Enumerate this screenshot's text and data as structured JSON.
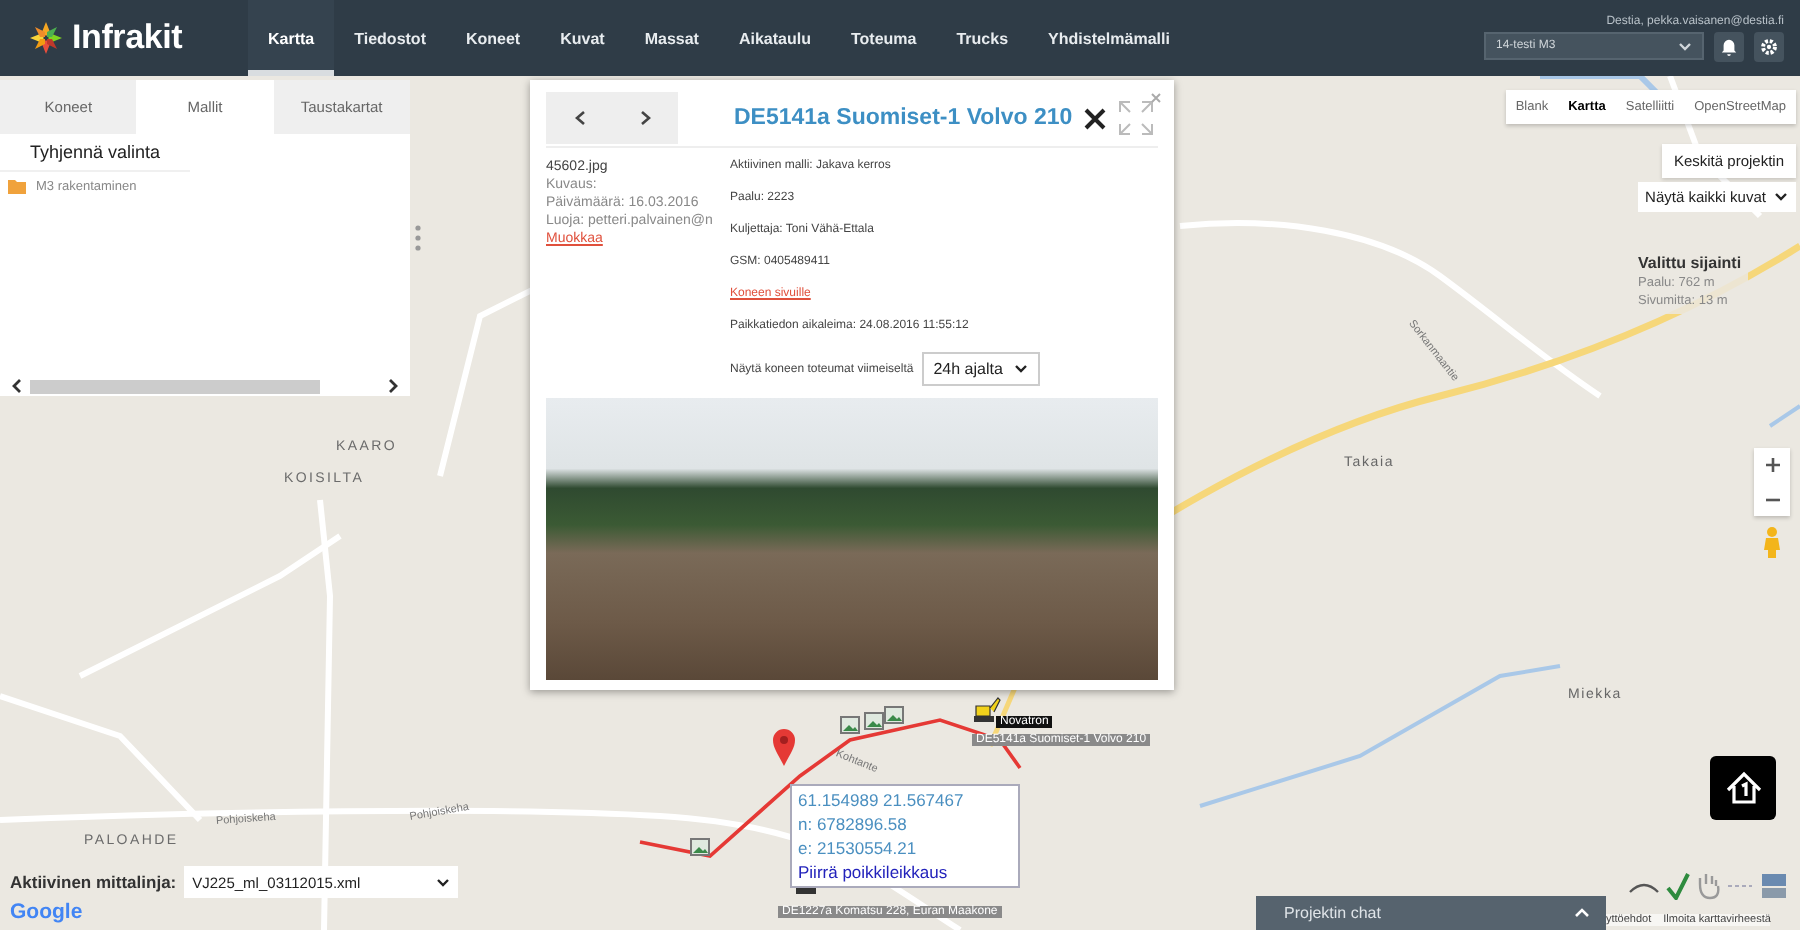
{
  "header": {
    "logo": "Infrakit",
    "user": "Destia, pekka.vaisanen@destia.fi",
    "project_select": "14-testi M3",
    "nav": [
      {
        "label": "Kartta",
        "selected": true
      },
      {
        "label": "Tiedostot",
        "selected": false
      },
      {
        "label": "Koneet",
        "selected": false
      },
      {
        "label": "Kuvat",
        "selected": false
      },
      {
        "label": "Massat",
        "selected": false
      },
      {
        "label": "Aikataulu",
        "selected": false
      },
      {
        "label": "Toteuma",
        "selected": false
      },
      {
        "label": "Trucks",
        "selected": false
      },
      {
        "label": "Yhdistelmämalli",
        "selected": false
      }
    ]
  },
  "side_panel": {
    "tabs": [
      {
        "label": "Koneet",
        "selected": false
      },
      {
        "label": "Mallit",
        "selected": true
      },
      {
        "label": "Taustakartat",
        "selected": false
      }
    ],
    "clear_button": "Tyhjennä valinta",
    "tree": [
      {
        "label": "M3 rakentaminen"
      }
    ]
  },
  "popup": {
    "title": "DE5141a Suomiset-1 Volvo 210",
    "image": {
      "filename": "45602.jpg",
      "description": "Kuvaus:",
      "date": "Päivämäärä: 16.03.2016",
      "creator": "Luoja: petteri.palvainen@n",
      "edit_link": "Muokkaa"
    },
    "machine": {
      "model": "Aktiivinen malli: Jakava kerros",
      "station": "Paalu: 2223",
      "driver": "Kuljettaja: Toni Vähä-Ettala",
      "gsm": "GSM: 0405489411",
      "link": "Koneen sivuille",
      "timestamp": "Paikkatiedon aikaleima: 24.08.2016 11:55:12",
      "history_label": "Näytä koneen toteumat viimeiseltä",
      "history_select": "24h ajalta"
    }
  },
  "map": {
    "types": [
      {
        "label": "Blank",
        "selected": false
      },
      {
        "label": "Kartta",
        "selected": true
      },
      {
        "label": "Satelliitti",
        "selected": false
      },
      {
        "label": "OpenStreetMap",
        "selected": false
      }
    ],
    "center_button": "Keskitä projektin",
    "photos_select": "Näytä kaikki kuvat",
    "location_info": {
      "title": "Valittu sijainti",
      "station": "Paalu: 762 m",
      "offset": "Sivumitta: 13 m"
    },
    "labels": [
      {
        "text": "KAARO",
        "kind": "place"
      },
      {
        "text": "KOISILTA",
        "kind": "place"
      },
      {
        "text": "PALOAHDE",
        "kind": "place"
      },
      {
        "text": "Takaia",
        "kind": "village"
      },
      {
        "text": "Miekka",
        "kind": "village"
      },
      {
        "text": "Pohjoiskeha",
        "kind": "road"
      },
      {
        "text": "Pohjoiskeha",
        "kind": "road"
      },
      {
        "text": "Sorkanmaantie",
        "kind": "road"
      },
      {
        "text": "Kohtante",
        "kind": "road"
      }
    ],
    "machines": [
      {
        "name": "DE5141a Suomiset-1 Volvo 210",
        "tag": "Novatron"
      },
      {
        "name": "DE1227a Komatsu 228, Euran Maakone"
      }
    ],
    "coordinates": {
      "latlon": "61.154989 21.567467",
      "north": "n: 6782896.58",
      "east": "e: 21530554.21",
      "link": "Piirrä poikkileikkaus"
    },
    "measure_line": {
      "label": "Aktiivinen mittalinja:",
      "value": "VJ225_ml_03112015.xml"
    },
    "google": "Google",
    "attribution": [
      "yttöehdot",
      "Ilmoita karttavirheestä"
    ]
  },
  "chat": {
    "title": "Projektin chat"
  }
}
